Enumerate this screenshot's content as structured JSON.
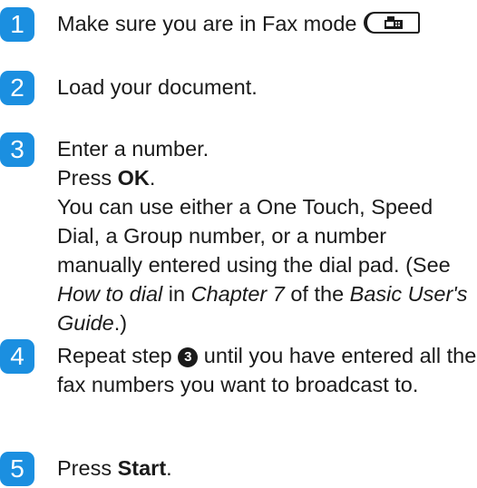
{
  "steps": [
    {
      "number": "1",
      "text": "Make sure you are in Fax mode",
      "mode_button_icon": "fax-icon"
    },
    {
      "number": "2",
      "text": "Load your document."
    },
    {
      "number": "3",
      "line1": "Enter a number.",
      "press_prefix": "Press ",
      "press_key": "OK",
      "press_suffix": ".",
      "detail_a": "You can use either a One Touch, Speed Dial, a Group number, or a number manually entered using the dial pad. (See ",
      "ref_topic": "How to dial",
      "detail_b": " in ",
      "ref_chapter": "Chapter 7",
      "detail_c": " of the ",
      "ref_guide": "Basic User's Guide",
      "detail_d": ".)"
    },
    {
      "number": "4",
      "text_a": "Repeat step ",
      "step_ref": "3",
      "text_b": " until you have entered all the fax numbers you want to broadcast to."
    },
    {
      "number": "5",
      "press_prefix": "Press ",
      "press_key": "Start",
      "press_suffix": "."
    }
  ],
  "colors": {
    "step_badge": "#1b8fe0",
    "text": "#1a1a1a"
  }
}
